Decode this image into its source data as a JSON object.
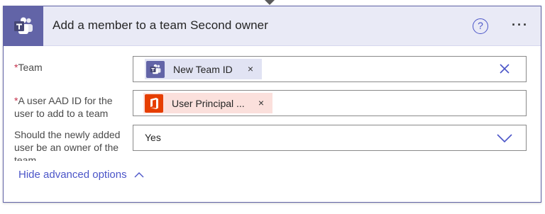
{
  "action": {
    "title": "Add a member to a team Second owner",
    "help_glyph": "?",
    "more_glyph": "···",
    "icon": "teams-icon",
    "accent_color": "#6264a7"
  },
  "fields": {
    "team": {
      "required_mark": "*",
      "label": "Team",
      "token_label": "New Team ID",
      "token_icon": "teams-icon",
      "remove_glyph": "×",
      "clear_icon": "close-icon"
    },
    "user": {
      "required_mark": "*",
      "label_line1": "A user AAD ID for the",
      "label_line2": "user to add to a team",
      "token_label": "User Principal ...",
      "token_icon": "office-icon",
      "token_color": "#e63e00",
      "remove_glyph": "×"
    },
    "owner": {
      "label_line1": "Should the newly added",
      "label_line2": "user be an owner of the",
      "value": "Yes",
      "dropdown_icon": "chevron-down-icon"
    }
  },
  "advanced": {
    "label": "Hide advanced options",
    "icon": "chevron-up-icon"
  }
}
